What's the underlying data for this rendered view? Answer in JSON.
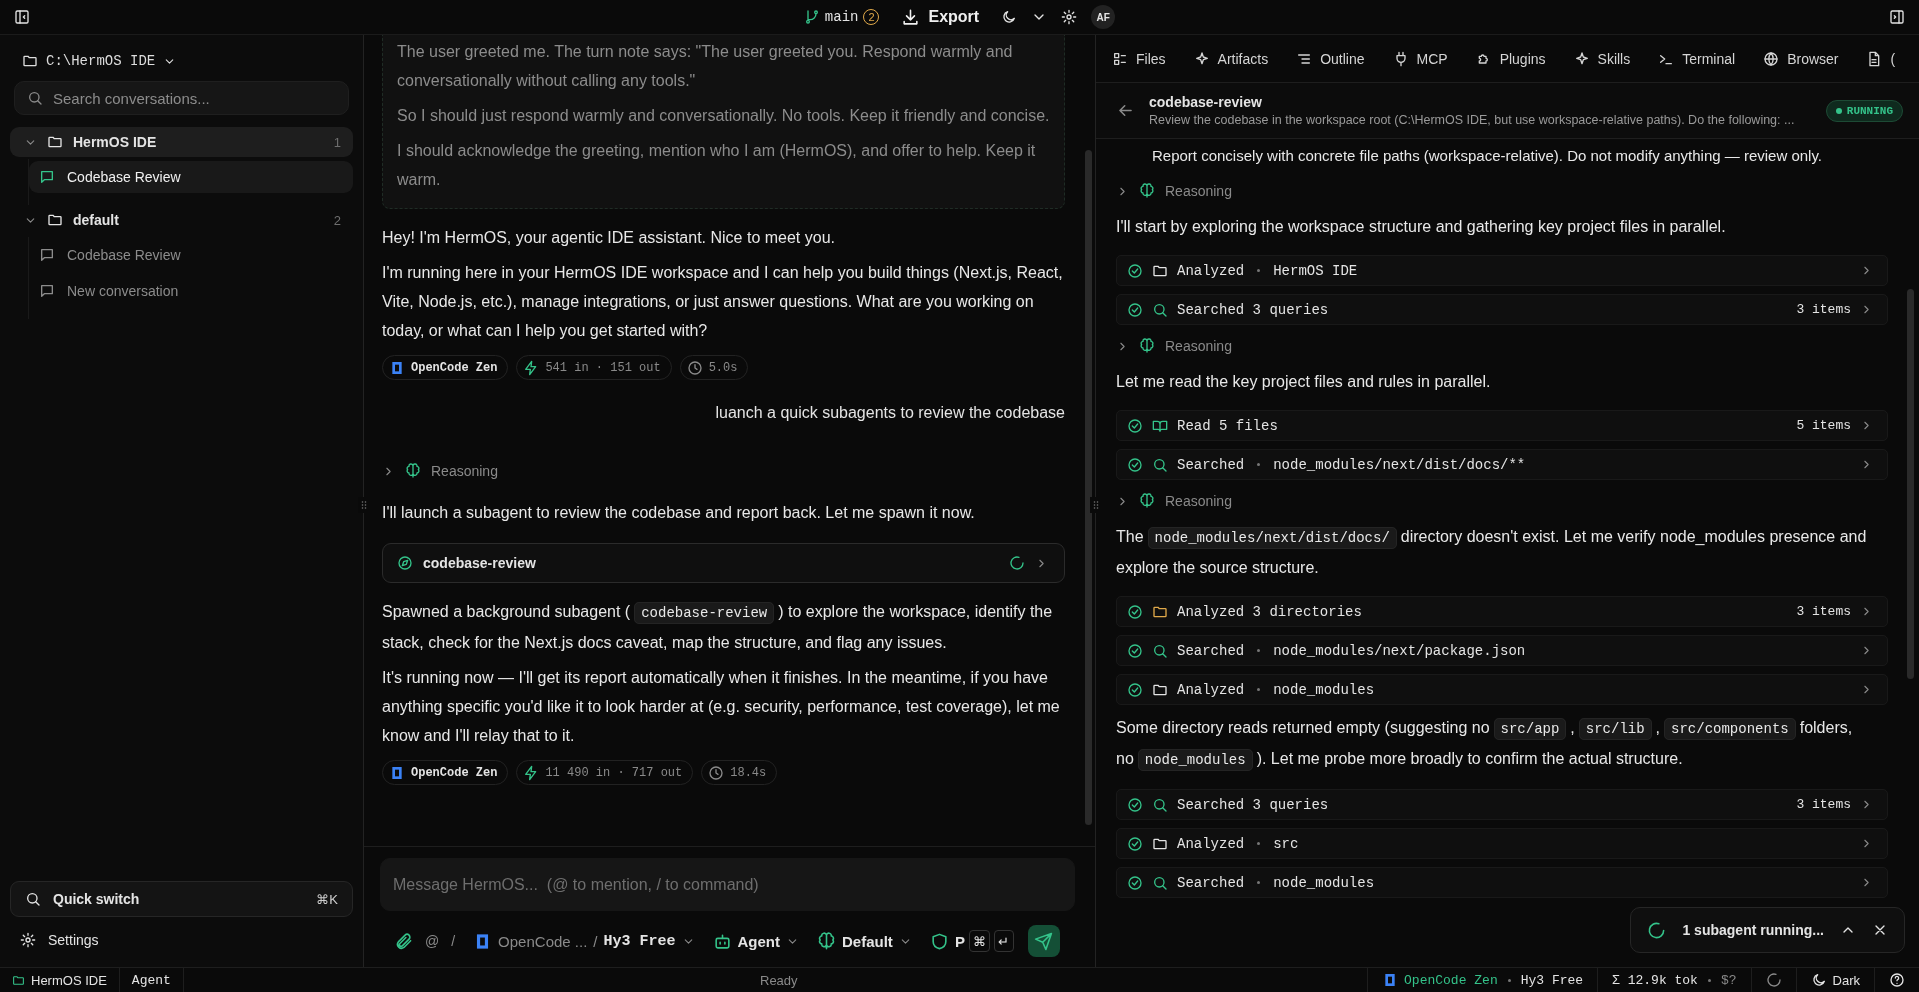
{
  "top_bar": {
    "branch": "main",
    "branch_count": "2",
    "export": "Export",
    "avatar": "AF"
  },
  "sidebar": {
    "workspace": "C:\\HermOS IDE",
    "search_placeholder": "Search conversations...",
    "groups": [
      {
        "name": "HermOS IDE",
        "count": "1",
        "expanded": true,
        "selected": true,
        "items": [
          {
            "title": "Codebase Review",
            "selected": true
          }
        ]
      },
      {
        "name": "default",
        "count": "2",
        "expanded": true,
        "selected": false,
        "items": [
          {
            "title": "Codebase Review",
            "selected": false
          },
          {
            "title": "New conversation",
            "selected": false
          }
        ]
      }
    ],
    "quick_switch": "Quick switch",
    "quick_switch_key": "⌘K",
    "settings": "Settings"
  },
  "chat": {
    "messages": [
      {
        "kind": "thinking",
        "paragraphs": [
          "The user greeted me. The turn note says: \"The user greeted you. Respond warmly and conversationally without calling any tools.\"",
          "So I should just respond warmly and conversationally. No tools. Keep it friendly and concise.",
          "I should acknowledge the greeting, mention who I am (HermOS), and offer to help. Keep it warm."
        ]
      },
      {
        "kind": "assistant",
        "paragraphs": [
          [
            {
              "kind": "text",
              "text": "Hey! I'm HermOS, your agentic IDE assistant. Nice to meet you."
            }
          ],
          [
            {
              "kind": "text",
              "text": "I'm running here in your HermOS IDE workspace and I can help you build things (Next.js, React, Vite, Node.js, etc.), manage integrations, or just answer questions. What are you working on today, or what can I help you get started with?"
            }
          ]
        ],
        "meta": {
          "model": "OpenCode Zen",
          "tokens": "541 in · 151 out",
          "duration": "5.0s"
        }
      },
      {
        "kind": "user",
        "text": "luanch a quick subagents to review the codebase"
      },
      {
        "kind": "reasoning",
        "label": "Reasoning",
        "expanded": false
      },
      {
        "kind": "assistant",
        "paragraphs": [
          [
            {
              "kind": "text",
              "text": "I'll launch a subagent to review the codebase and report back. Let me spawn it now."
            }
          ]
        ]
      },
      {
        "kind": "subagent",
        "name": "codebase-review",
        "running": true
      },
      {
        "kind": "assistant",
        "paragraphs": [
          [
            {
              "kind": "text",
              "text": "Spawned a background subagent ("
            },
            {
              "kind": "code",
              "text": "codebase-review"
            },
            {
              "kind": "text",
              "text": ") to explore the workspace, identify the stack, check for the Next.js docs caveat, map the structure, and flag any issues."
            }
          ],
          [
            {
              "kind": "text",
              "text": "It's running now — I'll get its report automatically when it finishes. In the meantime, if you have anything specific you'd like it to look harder at (e.g. security, performance, test coverage), let me know and I'll relay that to it."
            }
          ]
        ],
        "meta": {
          "model": "OpenCode Zen",
          "tokens": "11 490 in · 717 out",
          "duration": "18.4s"
        }
      }
    ]
  },
  "composer": {
    "placeholder": "Message HermOS...  (@ to mention, / to command)",
    "mention": "@",
    "command": "/",
    "provider": "OpenCode ...",
    "model_separator": "/",
    "model": "Hy3 Free",
    "mode": "Agent",
    "profile": "Default",
    "permission": "P",
    "keys": [
      "⌘",
      "↵"
    ]
  },
  "right_panel": {
    "tabs": [
      {
        "label": "Files"
      },
      {
        "label": "Artifacts"
      },
      {
        "label": "Outline"
      },
      {
        "label": "MCP"
      },
      {
        "label": "Plugins"
      },
      {
        "label": "Skills"
      },
      {
        "label": "Terminal"
      },
      {
        "label": "Browser"
      },
      {
        "label": "("
      }
    ],
    "subagent": {
      "name": "codebase-review",
      "description": "Review the codebase in the workspace root (C:\\HermOS IDE, but use workspace-relative paths). Do the following: ...",
      "status": "RUNNING"
    },
    "feed": [
      {
        "kind": "text",
        "text": "Report concisely with concrete file paths (workspace-relative). Do not modify anything — review only."
      },
      {
        "kind": "reasoning",
        "label": "Reasoning"
      },
      {
        "kind": "paragraph",
        "segments": [
          {
            "kind": "text",
            "text": "I'll start by exploring the workspace structure and gathering key project files in parallel."
          }
        ]
      },
      {
        "kind": "folder-tool",
        "done": true,
        "label": "Analyzed",
        "target": "HermOS IDE"
      },
      {
        "kind": "search-tool",
        "done": true,
        "label": "Searched 3 queries",
        "count": "3 items"
      },
      {
        "kind": "reasoning",
        "label": "Reasoning"
      },
      {
        "kind": "paragraph",
        "segments": [
          {
            "kind": "text",
            "text": "Let me read the key project files and rules in parallel."
          }
        ]
      },
      {
        "kind": "read-tool",
        "done": true,
        "label": "Read 5 files",
        "count": "5 items"
      },
      {
        "kind": "search-tool",
        "done": true,
        "label": "Searched",
        "target": "node_modules/next/dist/docs/**"
      },
      {
        "kind": "reasoning",
        "label": "Reasoning"
      },
      {
        "kind": "paragraph",
        "segments": [
          {
            "kind": "text",
            "text": "The"
          },
          {
            "kind": "code",
            "text": "node_modules/next/dist/docs/"
          },
          {
            "kind": "text",
            "text": "directory doesn't exist. Let me verify node_modules presence and explore the source structure."
          }
        ]
      },
      {
        "kind": "folders-tool",
        "done": true,
        "label": "Analyzed 3 directories",
        "count": "3 items"
      },
      {
        "kind": "search-tool",
        "done": true,
        "label": "Searched",
        "target": "node_modules/next/package.json"
      },
      {
        "kind": "folder-tool",
        "done": true,
        "label": "Analyzed",
        "target": "node_modules"
      },
      {
        "kind": "paragraph",
        "segments": [
          {
            "kind": "text",
            "text": "Some directory reads returned empty (suggesting no"
          },
          {
            "kind": "code",
            "text": "src/app"
          },
          {
            "kind": "text",
            "text": ","
          },
          {
            "kind": "code",
            "text": "src/lib"
          },
          {
            "kind": "text",
            "text": ","
          },
          {
            "kind": "code",
            "text": "src/components"
          },
          {
            "kind": "text",
            "text": "folders, no"
          },
          {
            "kind": "code",
            "text": "node_modules"
          },
          {
            "kind": "text",
            "text": "). Let me probe more broadly to confirm the actual structure."
          }
        ]
      },
      {
        "kind": "search-tool",
        "done": true,
        "label": "Searched 3 queries",
        "count": "3 items"
      },
      {
        "kind": "folder-tool",
        "done": true,
        "label": "Analyzed",
        "target": "src"
      },
      {
        "kind": "search-tool",
        "done": true,
        "label": "Searched",
        "target": "node_modules"
      }
    ],
    "toast": {
      "text": "1 subagent running..."
    }
  },
  "status_bar": {
    "workspace": "HermOS IDE",
    "mode": "Agent",
    "status": "Ready",
    "provider": "OpenCode Zen",
    "model": "Hy3 Free",
    "tokens": "Σ 12.9k tok",
    "cost": "$?",
    "theme": "Dark"
  }
}
